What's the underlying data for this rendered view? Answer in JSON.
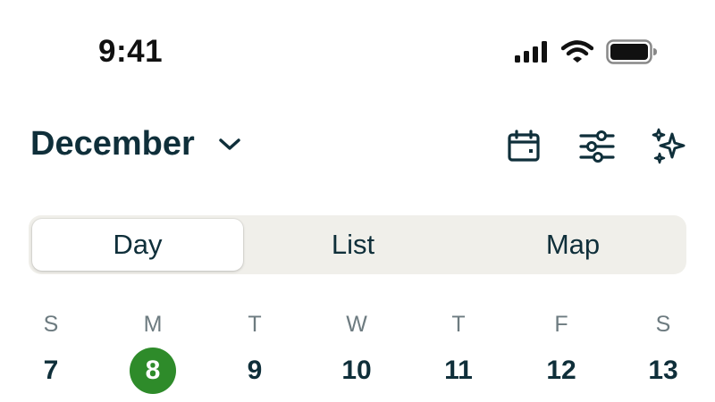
{
  "status_bar": {
    "time": "9:41",
    "icons": [
      "signal-icon",
      "wifi-icon",
      "battery-icon"
    ]
  },
  "header": {
    "month": "December",
    "actions": [
      {
        "name": "calendar-button",
        "icon": "calendar-icon"
      },
      {
        "name": "filter-button",
        "icon": "sliders-icon"
      },
      {
        "name": "ai-sparkle-button",
        "icon": "sparkles-icon"
      }
    ]
  },
  "view_tabs": {
    "selected": "Day",
    "items": [
      "Day",
      "List",
      "Map"
    ]
  },
  "week": {
    "days": [
      {
        "letter": "S",
        "number": "7"
      },
      {
        "letter": "M",
        "number": "8",
        "selected": true
      },
      {
        "letter": "T",
        "number": "9"
      },
      {
        "letter": "W",
        "number": "10"
      },
      {
        "letter": "T",
        "number": "11"
      },
      {
        "letter": "F",
        "number": "12"
      },
      {
        "letter": "S",
        "number": "13"
      }
    ]
  },
  "colors": {
    "text_primary": "#0f2f3a",
    "selected_day": "#2e8b2a",
    "segment_bg": "#f0efea",
    "muted": "#6d7b80"
  }
}
